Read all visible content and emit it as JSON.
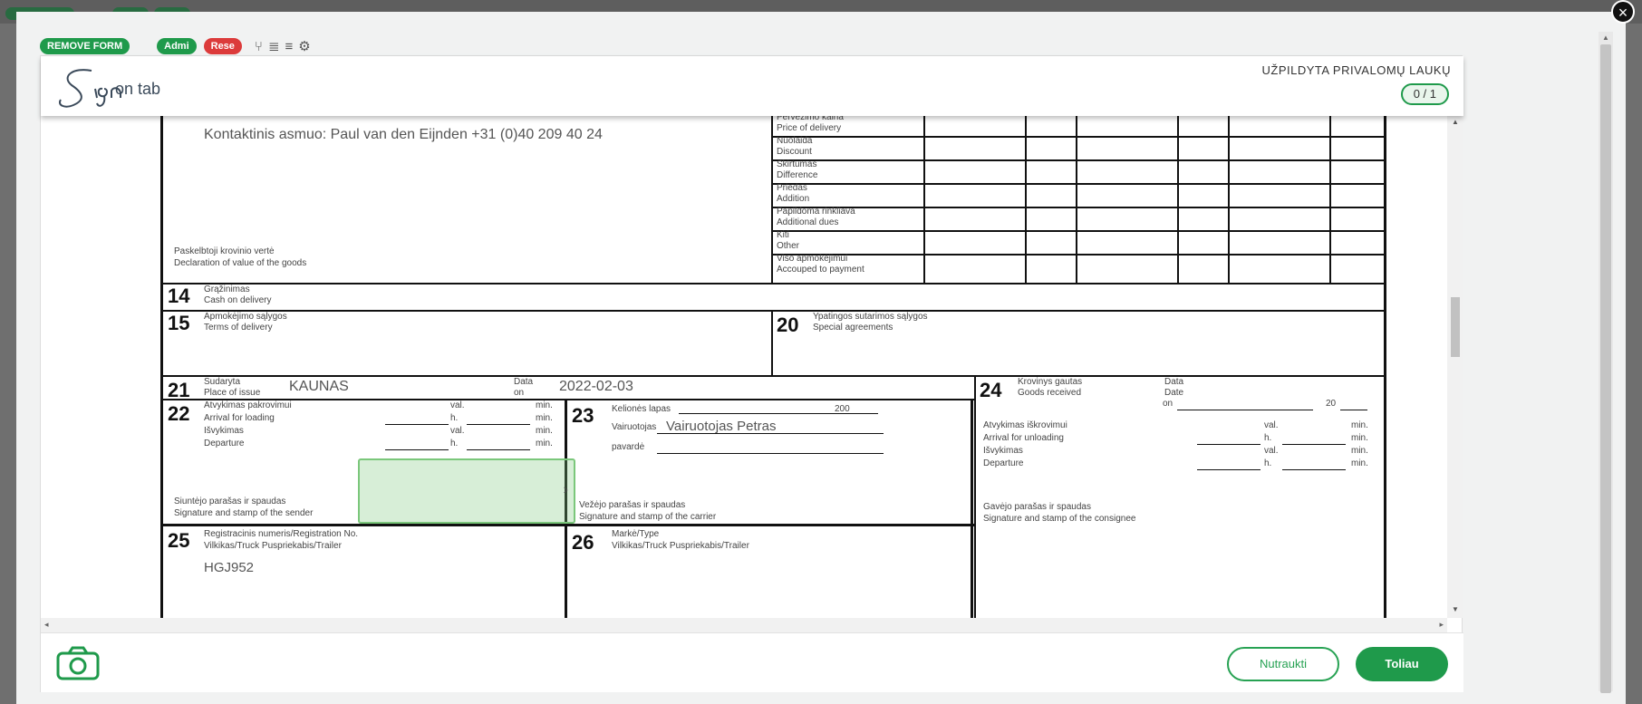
{
  "toolbar": {
    "remove_form": "REMOVE FORM",
    "admin": "Admi",
    "reset": "Rese"
  },
  "header": {
    "logo_sign": "Sign",
    "logo_sub": "on tab",
    "required_label": "UŽPILDYTA PRIVALOMŲ LAUKŲ",
    "counter": "0 / 1"
  },
  "document": {
    "contact": "Kontaktinis asmuo: Paul van den Eijnden +31 (0)40 209 40 24",
    "declared_lt": "Paskelbtoji krovinio vertė",
    "declared_en": "Declaration of value of the goods",
    "right_table": [
      "Pervežimo kaina",
      "Price of delivery",
      "Nuolaida",
      "Discount",
      "Skirtumas",
      "Difference",
      "Priedas",
      "Addition",
      "Papildoma rinkliava",
      "Additional dues",
      "Kiti",
      "Other",
      "Viso apmokėjimui",
      "Accouped to payment"
    ],
    "s14_lt": "Grąžinimas",
    "s14_en": "Cash on delivery",
    "s15_lt": "Apmokėjimo sąlygos",
    "s15_en": "Terms of delivery",
    "s20_lt": "Ypatingos sutarimos sąlygos",
    "s20_en": "Special agreements",
    "s21_lt": "Sudaryta",
    "s21_en": "Place of issue",
    "s21_value": "KAUNAS",
    "date_lt": "Data",
    "date_en": "on",
    "date_value": "2022-02-03",
    "s24_lt": "Krovinys gautas",
    "s24_en": "Goods received",
    "s24_date_lt": "Data",
    "s24_date_en": "Date",
    "s24_on": "on",
    "s24_year": "20",
    "s22_lines": [
      "Atvykimas pakrovimui",
      "Arrival for loading",
      "Išvykimas",
      "Departure"
    ],
    "s24_lines": [
      "Atvykimas iškrovimui",
      "Arrival for unloading",
      "Išvykimas",
      "Departure"
    ],
    "unit_val": "val.",
    "unit_h": "h.",
    "unit_min": "min.",
    "s22_sign_lt": "Siuntėjo parašas ir spaudas",
    "s22_sign_en": "Signature and stamp of the sender",
    "s23_route": "Kelionės lapas",
    "s23_year": "200",
    "s23_driver_lt": "Vairuotojas",
    "s23_driver_value": "Vairuotojas Petras",
    "s23_surname": "pavardė",
    "s23_sign_lt": "Vežėjo parašas ir spaudas",
    "s23_sign_en": "Signature and stamp of the carrier",
    "s24_sign_lt": "Gavėjo parašas ir spaudas",
    "s24_sign_en": "Signature and stamp of the consignee",
    "s25_lt": "Registracinis numeris/Registration No.",
    "s25_en": "Vilkikas/Truck Puspriekabis/Trailer",
    "s25_value": "HGJ952",
    "s26_lt": "Markė/Type",
    "s26_en": "Vilkikas/Truck Puspriekabis/Trailer",
    "numbers": {
      "n14": "14",
      "n15": "15",
      "n20": "20",
      "n21": "21",
      "n22": "22",
      "n23": "23",
      "n24": "24",
      "n25": "25",
      "n26": "26"
    }
  },
  "footer": {
    "cancel": "Nutraukti",
    "next": "Toliau"
  },
  "colors": {
    "brand_green": "#1f9a4b",
    "danger_red": "#dc3b3b",
    "signature_fill": "#7bc77b"
  },
  "icons": [
    "close-icon",
    "branch-icon",
    "list-icon",
    "menu-icon",
    "settings-icon",
    "camera-icon",
    "chevron-right-icon"
  ]
}
